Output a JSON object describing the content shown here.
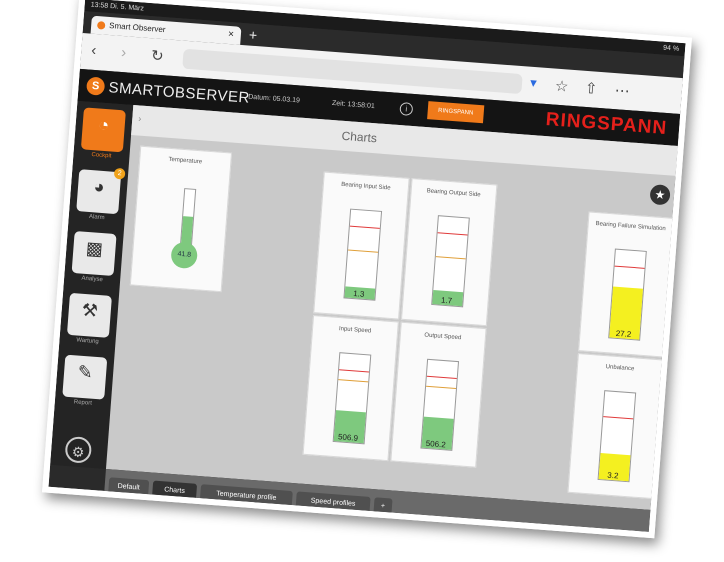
{
  "status": {
    "time_date": "13:58  Di. 5. März",
    "battery": "94 %"
  },
  "browser": {
    "tab_title": "Smart Observer",
    "tab_close": "×",
    "new_tab": "+"
  },
  "app": {
    "name": "SMARTOBSERVER",
    "date_label": "Datum: 05.03.19",
    "time_label": "Zeit: 13:58:01",
    "ringspann_button": "RINGSPANN",
    "brand": "RINGSPANN"
  },
  "sidebar": {
    "items": [
      {
        "label": "Cockpit",
        "icon": "gauge-icon",
        "active": true
      },
      {
        "label": "Alarm",
        "icon": "alarm-gauge-icon",
        "badge": "2"
      },
      {
        "label": "Analyse",
        "icon": "bar-chart-icon"
      },
      {
        "label": "Wartung",
        "icon": "wrench-icon"
      },
      {
        "label": "Report",
        "icon": "report-chart-icon"
      }
    ]
  },
  "content": {
    "title": "Charts",
    "cards": {
      "temperature": {
        "title": "Temperature",
        "value": "41.8",
        "level": 0.55
      },
      "bearing_input": {
        "title": "Bearing Input Side",
        "value": "1.3",
        "level": 0.12
      },
      "bearing_output": {
        "title": "Bearing Output Side",
        "value": "1.7",
        "level": 0.16
      },
      "input_speed": {
        "title": "Input Speed",
        "value": "506.9",
        "level": 0.35
      },
      "output_speed": {
        "title": "Output Speed",
        "value": "506.2",
        "level": 0.35
      },
      "bearing_failure": {
        "title": "Bearing Failure Simulation",
        "value": "27.2",
        "level": 0.58
      },
      "unbalance": {
        "title": "Unbalance",
        "value": "3.2",
        "level": 0.3
      }
    }
  },
  "colors": {
    "accent": "#f07a1a",
    "brand_red": "#e5201b",
    "green": "#7ec97e",
    "yellow": "#f4f020"
  },
  "bottom_tabs": [
    "Default",
    "Charts",
    "Temperature profile",
    "Speed profiles",
    "+"
  ]
}
